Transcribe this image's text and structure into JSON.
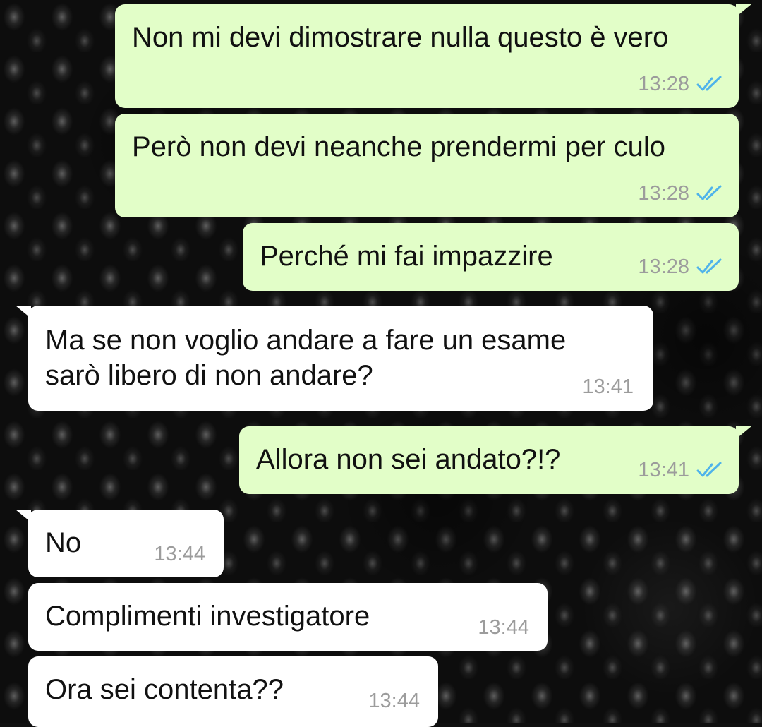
{
  "theme": {
    "outgoing_bubble": "#e2fec8",
    "incoming_bubble": "#ffffff",
    "read_tick_color": "#4fb3ea",
    "time_color": "#9c9c9c",
    "wallpaper": "dark blackberry photo"
  },
  "messages": [
    {
      "direction": "out",
      "text": "Non mi devi dimostrare nulla questo è vero",
      "time": "13:28",
      "status": "read-double-check-icon"
    },
    {
      "direction": "out",
      "text": "Però non devi neanche prendermi per culo",
      "time": "13:28",
      "status": "read-double-check-icon"
    },
    {
      "direction": "out",
      "text": "Perché mi fai impazzire",
      "time": "13:28",
      "status": "read-double-check-icon"
    },
    {
      "direction": "in",
      "text": "Ma se non voglio andare a fare un esame sarò libero di non andare?",
      "time": "13:41"
    },
    {
      "direction": "out",
      "text": "Allora non sei andato?!?",
      "time": "13:41",
      "status": "read-double-check-icon"
    },
    {
      "direction": "in",
      "text": "No",
      "time": "13:44"
    },
    {
      "direction": "in",
      "text": "Complimenti investigatore",
      "time": "13:44"
    },
    {
      "direction": "in",
      "text": "Ora sei contenta??",
      "time": "13:44"
    }
  ]
}
